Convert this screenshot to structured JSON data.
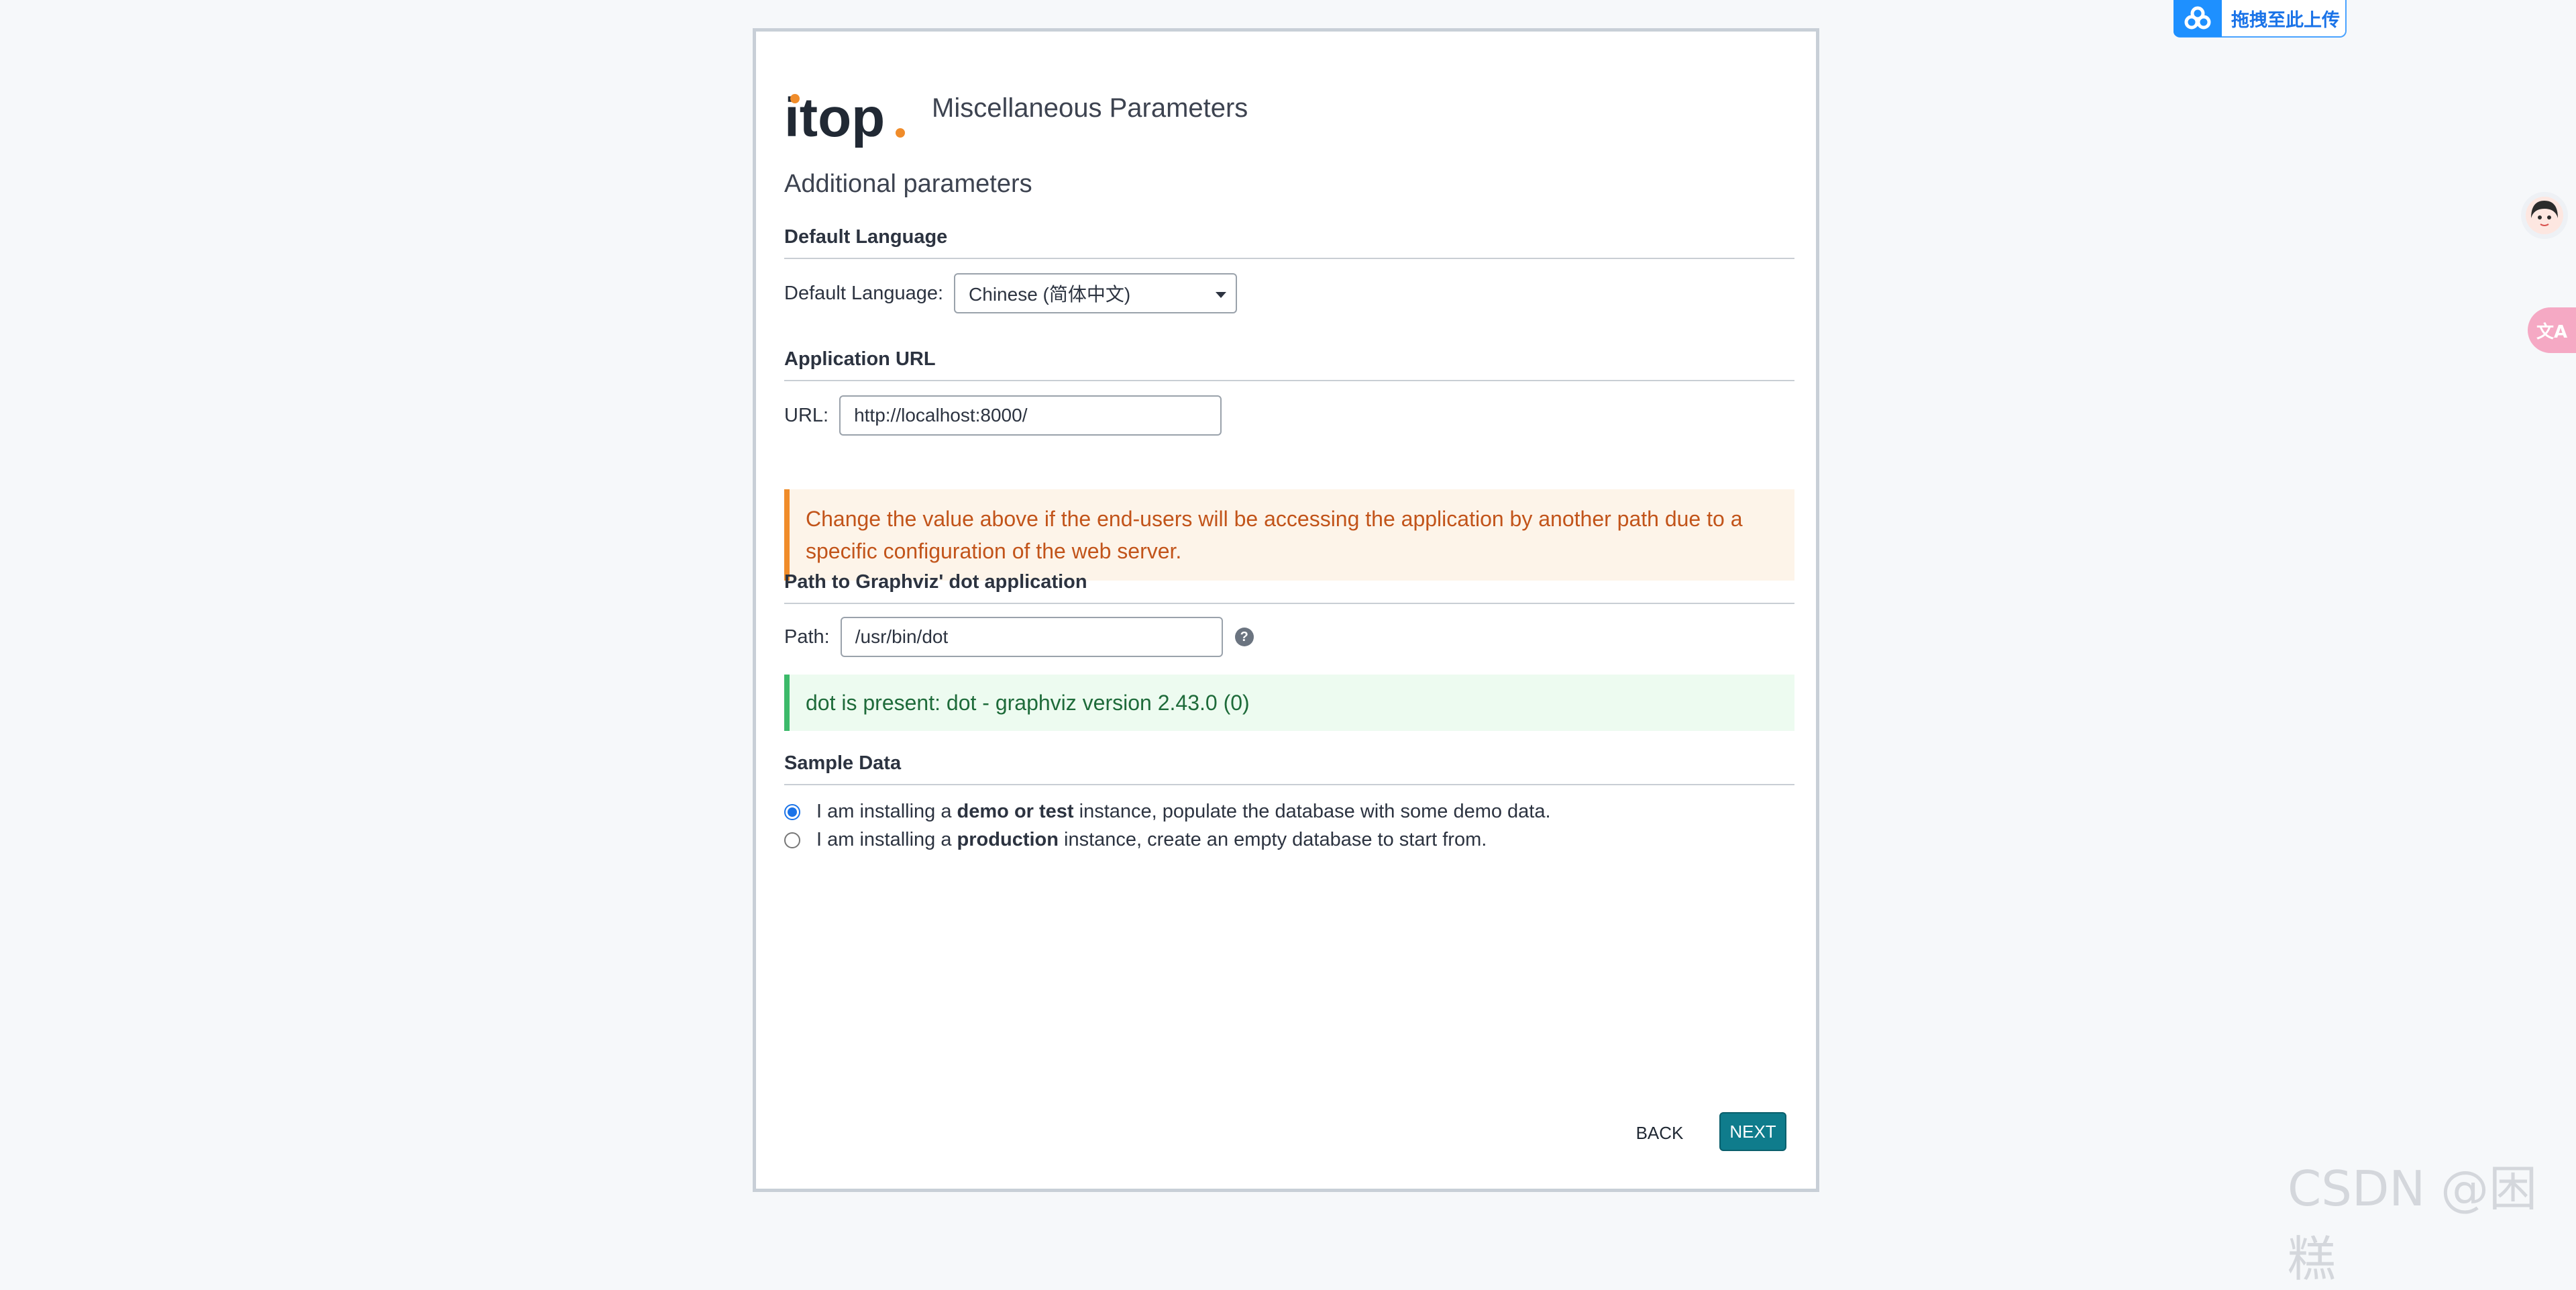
{
  "header": {
    "logo_text": "itop",
    "title": "Miscellaneous Parameters"
  },
  "subtitle": "Additional parameters",
  "default_language": {
    "section_title": "Default Language",
    "label": "Default Language:",
    "selected": "Chinese (简体中文)"
  },
  "application_url": {
    "section_title": "Application URL",
    "label": "URL:",
    "value": "http://localhost:8000/",
    "warning": "Change the value above if the end-users will be accessing the application by another path due to a specific configuration of the web server."
  },
  "graphviz": {
    "section_title": "Path to Graphviz' dot application",
    "label": "Path:",
    "value": "/usr/bin/dot",
    "help_icon": "question-circle-icon",
    "status": "dot is present: dot - graphviz version 2.43.0 (0)"
  },
  "sample_data": {
    "section_title": "Sample Data",
    "options": [
      {
        "prefix": "I am installing a ",
        "bold": "demo or test",
        "suffix": " instance, populate the database with some demo data.",
        "checked": true
      },
      {
        "prefix": "I am installing a ",
        "bold": "production",
        "suffix": " instance, create an empty database to start from.",
        "checked": false
      }
    ]
  },
  "buttons": {
    "back": "BACK",
    "next": "NEXT"
  },
  "overlay": {
    "upload_label": "拖拽至此上传",
    "upload_icon": "cloud-upload-icon",
    "avatar_icon": "assistant-avatar-icon",
    "translate_icon": "translate-icon",
    "watermark": "CSDN @困糕"
  },
  "colors": {
    "accent": "#0f7c8c",
    "logo_dot": "#f08c2a",
    "warning_text": "#c2541a",
    "success_text": "#1e6b3a"
  }
}
